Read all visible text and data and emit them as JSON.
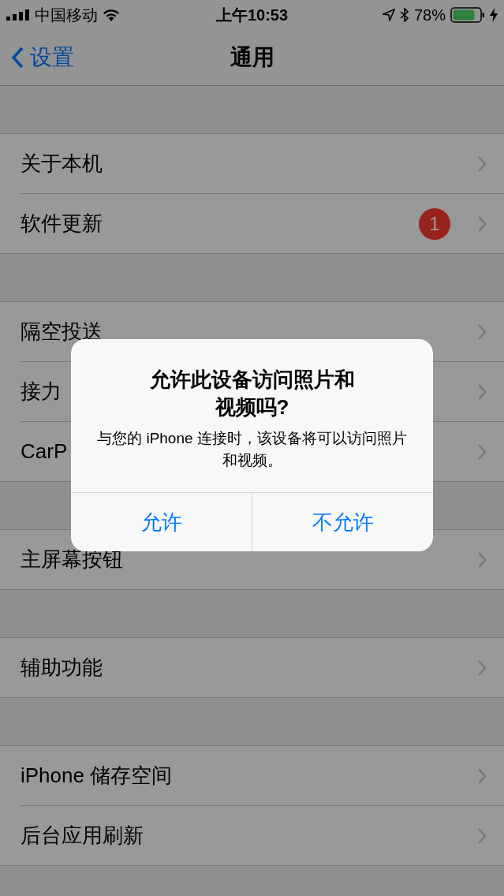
{
  "status_bar": {
    "carrier": "中国移动",
    "time": "上午10:53",
    "battery": "78%"
  },
  "nav": {
    "back": "设置",
    "title": "通用"
  },
  "groups": [
    [
      {
        "label": "关于本机"
      },
      {
        "label": "软件更新",
        "badge": "1"
      }
    ],
    [
      {
        "label": "隔空投送"
      },
      {
        "label": "接力"
      },
      {
        "label": "CarP"
      }
    ],
    [
      {
        "label": "主屏幕按钮"
      }
    ],
    [
      {
        "label": "辅助功能"
      }
    ],
    [
      {
        "label": "iPhone 储存空间"
      },
      {
        "label": "后台应用刷新"
      }
    ]
  ],
  "alert": {
    "title": "允许此设备访问照片和视频吗?",
    "message": "与您的 iPhone 连接时，该设备将可以访问照片和视频。",
    "buttons": [
      "允许",
      "不允许"
    ]
  }
}
